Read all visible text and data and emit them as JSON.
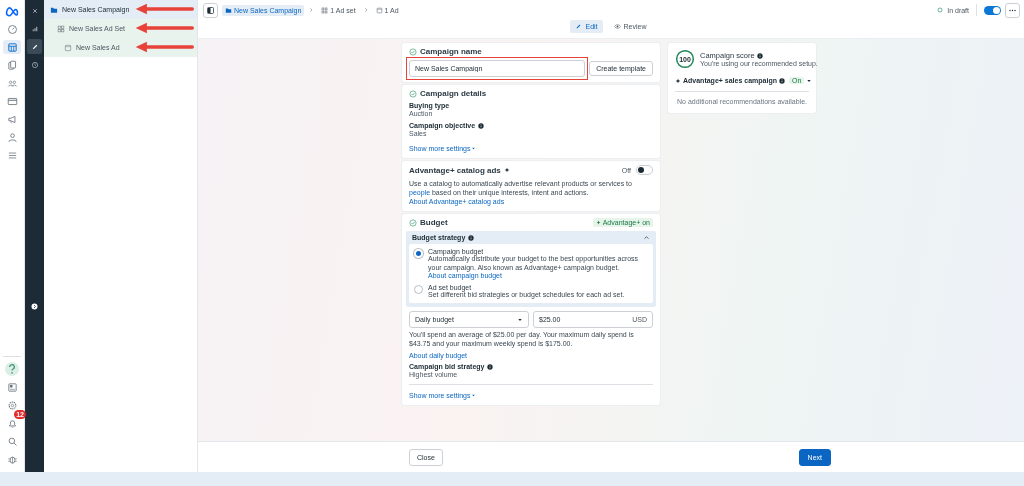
{
  "nav_rail": {
    "top": [
      {
        "kind": "logo",
        "selected": false
      },
      {
        "kind": "dashboard",
        "selected": false
      },
      {
        "kind": "table",
        "selected": true
      },
      {
        "kind": "pages",
        "selected": false
      },
      {
        "kind": "people",
        "selected": false
      },
      {
        "kind": "card",
        "selected": false
      },
      {
        "kind": "megaphone",
        "selected": false
      },
      {
        "kind": "person",
        "selected": false
      },
      {
        "kind": "menu",
        "selected": false
      }
    ],
    "bottom": [
      {
        "kind": "help",
        "selected": true
      },
      {
        "kind": "news",
        "selected": false
      },
      {
        "kind": "settings",
        "selected": false
      },
      {
        "kind": "bell",
        "selected": false,
        "badge": "12"
      },
      {
        "kind": "search",
        "selected": false
      },
      {
        "kind": "bug",
        "selected": false
      }
    ]
  },
  "tool_rail": {
    "items": [
      {
        "kind": "close",
        "selected": false
      },
      {
        "kind": "chart",
        "selected": false
      },
      {
        "kind": "edit",
        "selected": true
      },
      {
        "kind": "clock",
        "selected": false
      }
    ],
    "expand": {
      "kind": "expand"
    }
  },
  "tree": [
    {
      "label": "New Sales Campaign",
      "kind": "campaign",
      "selected": true,
      "annotated": true,
      "children": [
        {
          "label": "New Sales Ad Set",
          "kind": "adset",
          "selected": false,
          "annotated": true,
          "children": [
            {
              "label": "New Sales Ad",
              "kind": "ad",
              "selected": false,
              "annotated": true
            }
          ]
        }
      ]
    }
  ],
  "top_bar": {
    "breadcrumbs": [
      {
        "label": "New Sales Campaign",
        "kind": "campaign",
        "selected": true
      },
      {
        "label": "1 Ad set",
        "kind": "adset",
        "selected": false
      },
      {
        "label": "1 Ad",
        "kind": "ad",
        "selected": false
      }
    ],
    "status": "In draft",
    "toggle_on": true,
    "modes": [
      {
        "label": "Edit",
        "kind": "edit",
        "selected": true
      },
      {
        "label": "Review",
        "kind": "review",
        "selected": false
      }
    ]
  },
  "campaign_name": {
    "title": "Campaign name",
    "value": "New Sales Campaign",
    "highlighted": true,
    "button": "Create template"
  },
  "campaign_details": {
    "title": "Campaign details",
    "fields": [
      {
        "label": "Buying type",
        "value": "Auction",
        "info": false
      },
      {
        "label": "Campaign objective",
        "value": "Sales",
        "info": true
      }
    ],
    "link": "Show more settings"
  },
  "catalog_ads": {
    "title": "Advantage+ catalog ads",
    "toggle_label": "Off",
    "on": false,
    "description": [
      {
        "text": "Use a catalog to automatically advertise relevant products or services to "
      },
      {
        "link": "people"
      },
      {
        "text": " based on their unique interests, intent and actions. "
      },
      {
        "link": "About Advantage+ catalog ads"
      }
    ]
  },
  "budget": {
    "title": "Budget",
    "badge": "Advantage+ on",
    "strategy": {
      "title": "Budget strategy",
      "expanded": true,
      "options": [
        {
          "label": "Campaign budget",
          "selected": true,
          "description": "Automatically distribute your budget to the best opportunities across your campaign. Also known as Advantage+ campaign budget. ",
          "link": "About campaign budget"
        },
        {
          "label": "Ad set budget",
          "selected": false,
          "description": "Set different bid strategies or budget schedules for each ad set."
        }
      ]
    },
    "period": "Daily budget",
    "amount": "$25.00",
    "currency": "USD",
    "note": "You'll spend an average of $25.00 per day. Your maximum daily spend is $43.75 and your maximum weekly spend is $175.00.",
    "note_link": "About daily budget",
    "bid_label": "Campaign bid strategy",
    "bid_value": "Highest volume",
    "link": "Show more settings"
  },
  "score": {
    "value": "100",
    "level": 1,
    "title": "Campaign score",
    "subtitle": "You're using our recommended setup.",
    "item": "Advantage+ sales campaign",
    "item_status": "On",
    "empty": "No additional recommendations available."
  },
  "footer": {
    "close": "Close",
    "next": "Next"
  }
}
